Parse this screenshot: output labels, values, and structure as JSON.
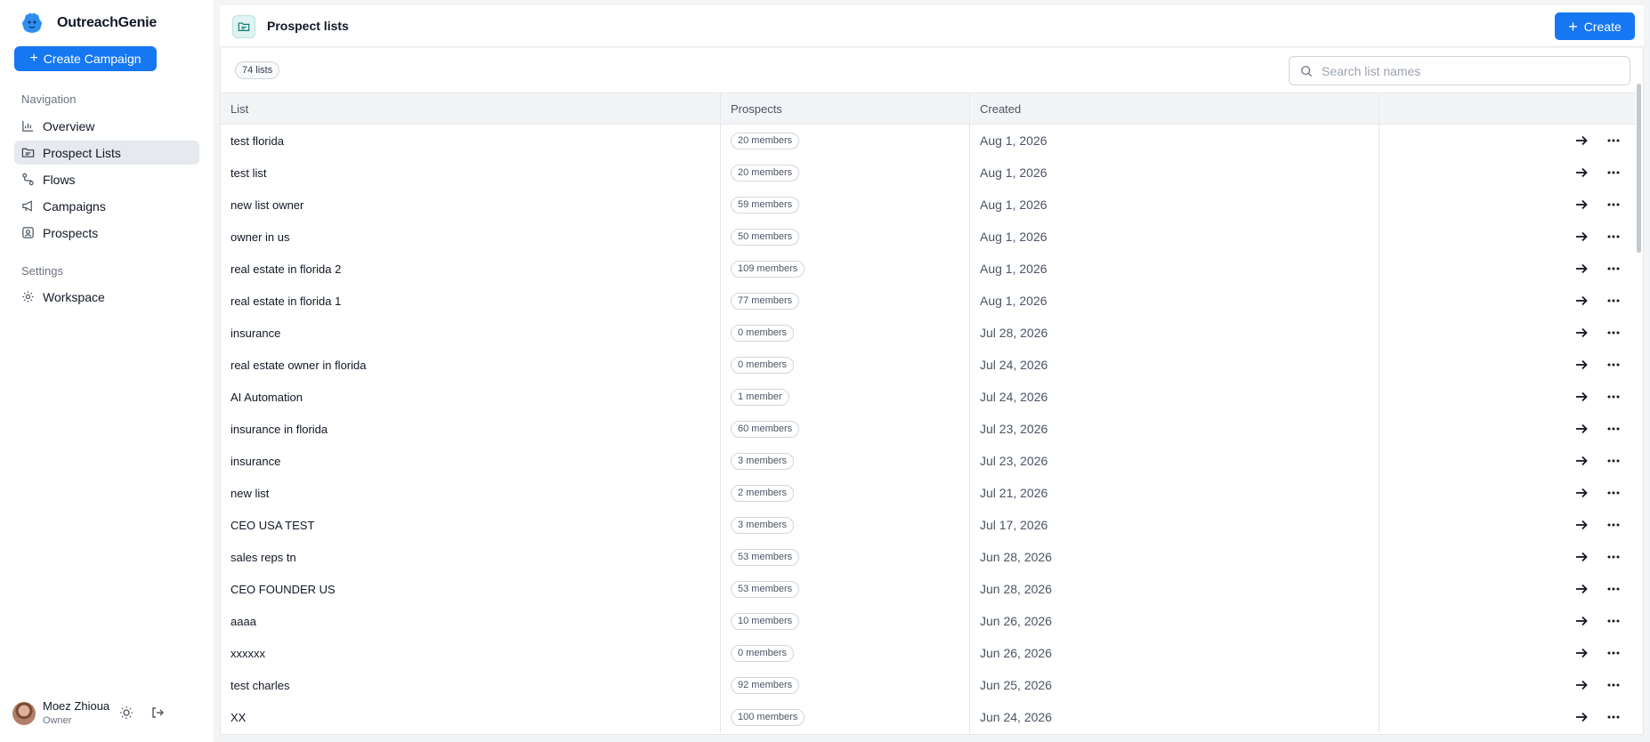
{
  "app": {
    "name": "OutreachGenie"
  },
  "sidebar": {
    "create_campaign_label": "Create Campaign",
    "nav_label": "Navigation",
    "nav_items": [
      {
        "label": "Overview",
        "icon": "bar-chart-icon",
        "active": false
      },
      {
        "label": "Prospect Lists",
        "icon": "folder-list-icon",
        "active": true
      },
      {
        "label": "Flows",
        "icon": "route-icon",
        "active": false
      },
      {
        "label": "Campaigns",
        "icon": "megaphone-icon",
        "active": false
      },
      {
        "label": "Prospects",
        "icon": "contact-card-icon",
        "active": false
      }
    ],
    "settings_label": "Settings",
    "settings_items": [
      {
        "label": "Workspace",
        "icon": "gear-icon"
      }
    ],
    "user": {
      "name": "Moez Zhioua",
      "role": "Owner"
    }
  },
  "header": {
    "title": "Prospect lists",
    "create_label": "Create"
  },
  "toolbar": {
    "count_label": "74 lists",
    "search_placeholder": "Search list names"
  },
  "table": {
    "columns": [
      "List",
      "Prospects",
      "Created",
      ""
    ],
    "rows": [
      {
        "name": "test florida",
        "members": "20 members",
        "created": "Aug 1, 2026"
      },
      {
        "name": "test list",
        "members": "20 members",
        "created": "Aug 1, 2026"
      },
      {
        "name": "new list owner",
        "members": "59 members",
        "created": "Aug 1, 2026"
      },
      {
        "name": "owner in us",
        "members": "50 members",
        "created": "Aug 1, 2026"
      },
      {
        "name": "real estate in florida 2",
        "members": "109 members",
        "created": "Aug 1, 2026"
      },
      {
        "name": "real estate in florida 1",
        "members": "77 members",
        "created": "Aug 1, 2026"
      },
      {
        "name": "insurance",
        "members": "0 members",
        "created": "Jul 28, 2026"
      },
      {
        "name": "real estate owner in florida",
        "members": "0 members",
        "created": "Jul 24, 2026"
      },
      {
        "name": "AI Automation",
        "members": "1 member",
        "created": "Jul 24, 2026"
      },
      {
        "name": "insurance in florida",
        "members": "60 members",
        "created": "Jul 23, 2026"
      },
      {
        "name": "insurance",
        "members": "3 members",
        "created": "Jul 23, 2026"
      },
      {
        "name": "new list",
        "members": "2 members",
        "created": "Jul 21, 2026"
      },
      {
        "name": "CEO USA TEST",
        "members": "3 members",
        "created": "Jul 17, 2026"
      },
      {
        "name": "sales reps tn",
        "members": "53 members",
        "created": "Jun 28, 2026"
      },
      {
        "name": "CEO FOUNDER US",
        "members": "53 members",
        "created": "Jun 28, 2026"
      },
      {
        "name": "aaaa",
        "members": "10 members",
        "created": "Jun 26, 2026"
      },
      {
        "name": "xxxxxx",
        "members": "0 members",
        "created": "Jun 26, 2026"
      },
      {
        "name": "test charles",
        "members": "92 members",
        "created": "Jun 25, 2026"
      },
      {
        "name": "XX",
        "members": "100 members",
        "created": "Jun 24, 2026"
      }
    ]
  },
  "colors": {
    "primary": "#1677f2",
    "active_nav": "#e6e9ee",
    "page_icon_bg": "#dff3f1"
  }
}
